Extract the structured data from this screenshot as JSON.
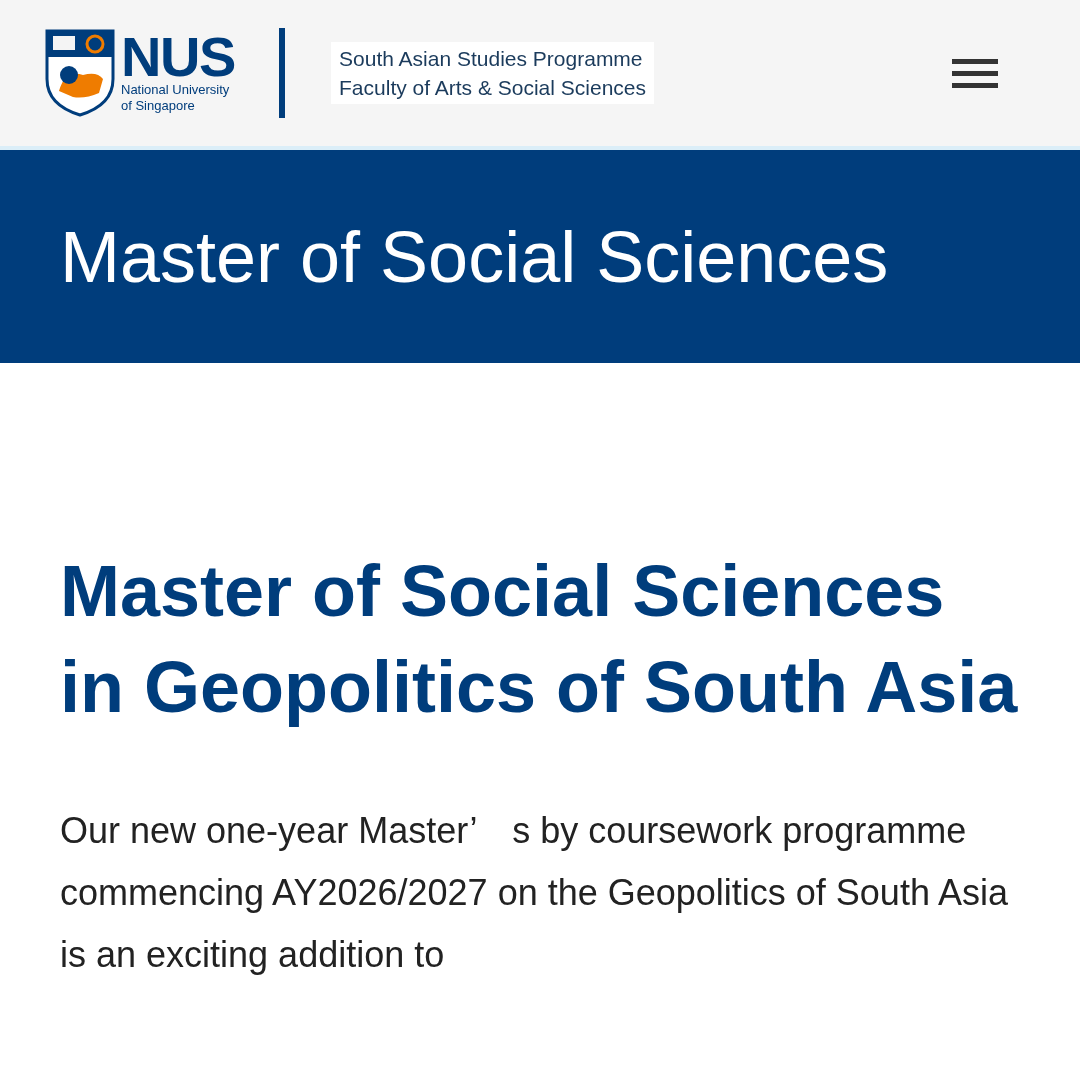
{
  "header": {
    "logo": {
      "wordmark": "NUS",
      "tagline_lines": [
        "National University",
        "of Singapore"
      ]
    },
    "department_lines": [
      "South Asian Studies Programme",
      "Faculty of Arts & Social Sciences"
    ]
  },
  "banner": {
    "title": "Master of Social Sciences"
  },
  "main": {
    "heading": "Master of Social Sciences in Geopolitics of South Asia",
    "intro": "Our new one-year Master’　s by coursework programme commencing AY2026/2027 on the Geopolitics of South Asia is an exciting addition to"
  }
}
